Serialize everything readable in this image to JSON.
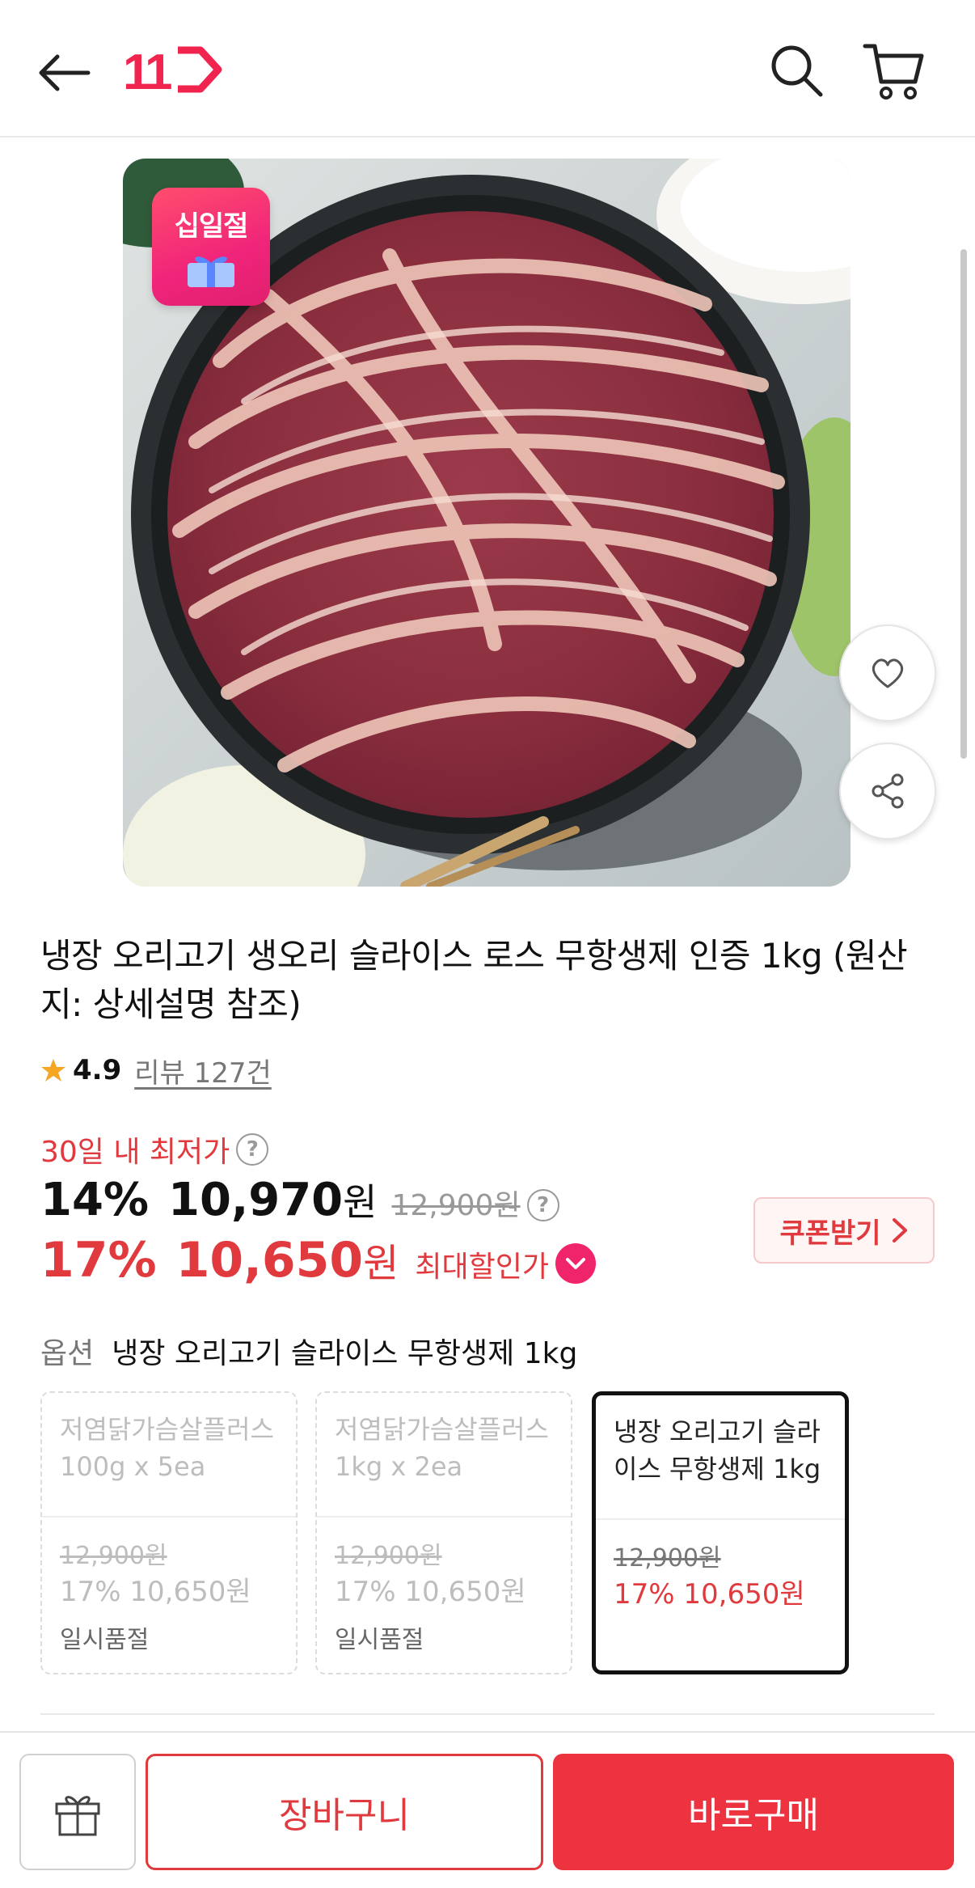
{
  "header": {
    "logo_text": "11",
    "icons": [
      "back-arrow-icon",
      "logo",
      "search-icon",
      "cart-icon"
    ]
  },
  "product": {
    "badge": "십일절",
    "title": "냉장 오리고기 생오리 슬라이스 로스 무항생제 인증 1kg (원산지: 상세설명 참조)",
    "rating": "4.9",
    "review_link": "리뷰 127건"
  },
  "price": {
    "lowest_label": "30일 내 최저가",
    "discount1": "14%",
    "price1": "10,970",
    "won": "원",
    "original": "12,900원",
    "discount2": "17%",
    "price2": "10,650",
    "max_label": "최대할인가",
    "coupon_button": "쿠폰받기"
  },
  "option": {
    "label": "옵션",
    "selected_value": "냉장 오리고기 슬라이스 무항생제 1kg",
    "cards": [
      {
        "name": "저염닭가슴살플러스 100g x 5ea",
        "original": "12,900원",
        "sale": "17% 10,650원",
        "status": "일시품절",
        "selected": false
      },
      {
        "name": "저염닭가슴살플러스 1kg x 2ea",
        "original": "12,900원",
        "sale": "17% 10,650원",
        "status": "일시품절",
        "selected": false
      },
      {
        "name": "냉장 오리고기 슬라이스 무항생제 1kg",
        "original": "12,900원",
        "sale": "17% 10,650원",
        "status": "",
        "selected": true
      }
    ]
  },
  "bottom_bar": {
    "cart_button": "장바구니",
    "buy_button": "바로구매"
  },
  "colors": {
    "accent": "#e0393e",
    "brand": "#f0246a",
    "buy_button": "#ee3340"
  }
}
